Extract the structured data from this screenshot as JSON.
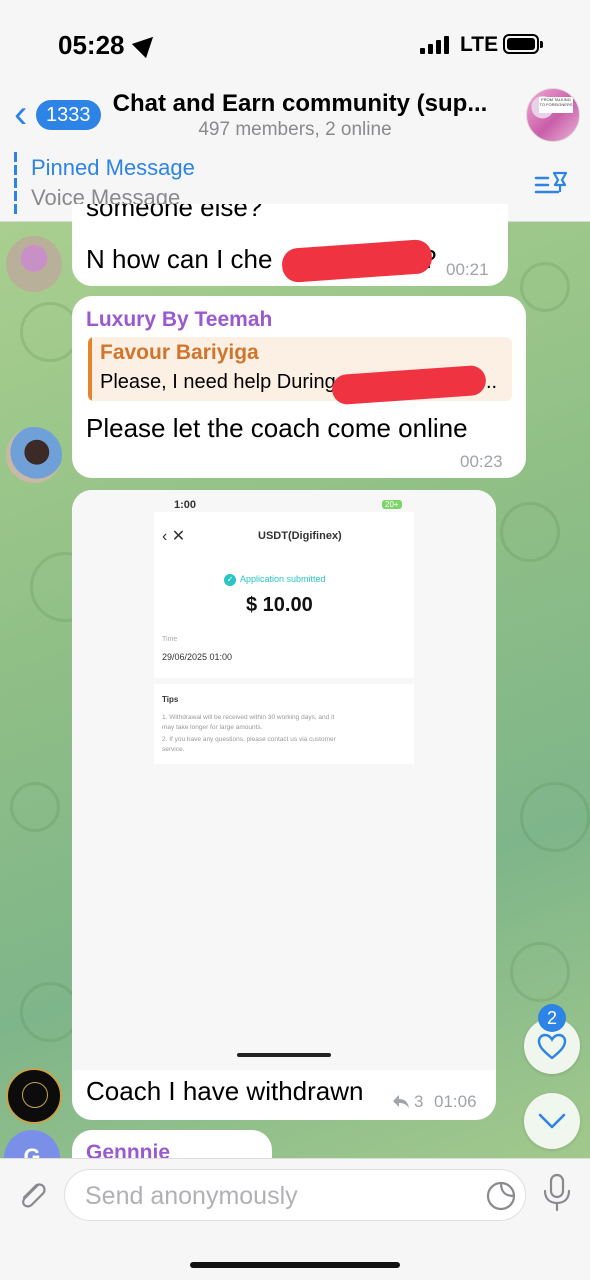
{
  "status_bar": {
    "time": "05:28",
    "network": "LTE"
  },
  "header": {
    "unread_count": "1333",
    "title": "Chat and Earn community (sup...",
    "subtitle": "497 members, 2 online",
    "avatar_text": "FROM TALKING TO FOREIGNERS"
  },
  "pinned": {
    "title": "Pinned Message",
    "text": "Voice Message"
  },
  "messages": [
    {
      "partial_text": "someone else?",
      "text_visible": "N how can I che",
      "text_end": "?",
      "time": "00:21"
    },
    {
      "sender": "Luxury By Teemah",
      "reply_sender": "Favour Bariyiga",
      "reply_text": "Please, I need help During st",
      "reply_ellipsis": "..",
      "text": "Please let the coach come online",
      "time": "00:23"
    },
    {
      "screenshot": {
        "time": "1:00",
        "battery_badge": "20+",
        "page_title": "USDT(Digifinex)",
        "status": "Application submitted",
        "amount": "$ 10.00",
        "time_label": "Time",
        "time_value": "29/06/2025 01:00",
        "tips_title": "Tips",
        "tip1a": "1. Withdrawal will be received within 30 working days, and it",
        "tip1b": "may take longer for large amounts.",
        "tip2a": "2. If you have any questions, please contact us via customer",
        "tip2b": "service."
      },
      "text": "Coach I have withdrawn",
      "reply_count": "3",
      "time": "01:06"
    },
    {
      "sender": "Gennnie",
      "avatar_letter": "G"
    }
  ],
  "floating": {
    "reaction_count": "2"
  },
  "input": {
    "placeholder": "Send anonymously"
  },
  "colors": {
    "accent": "#2d83e6",
    "sender_purple": "#9b59d0",
    "reply_orange": "#d0752b",
    "redaction": "#ef3340"
  }
}
